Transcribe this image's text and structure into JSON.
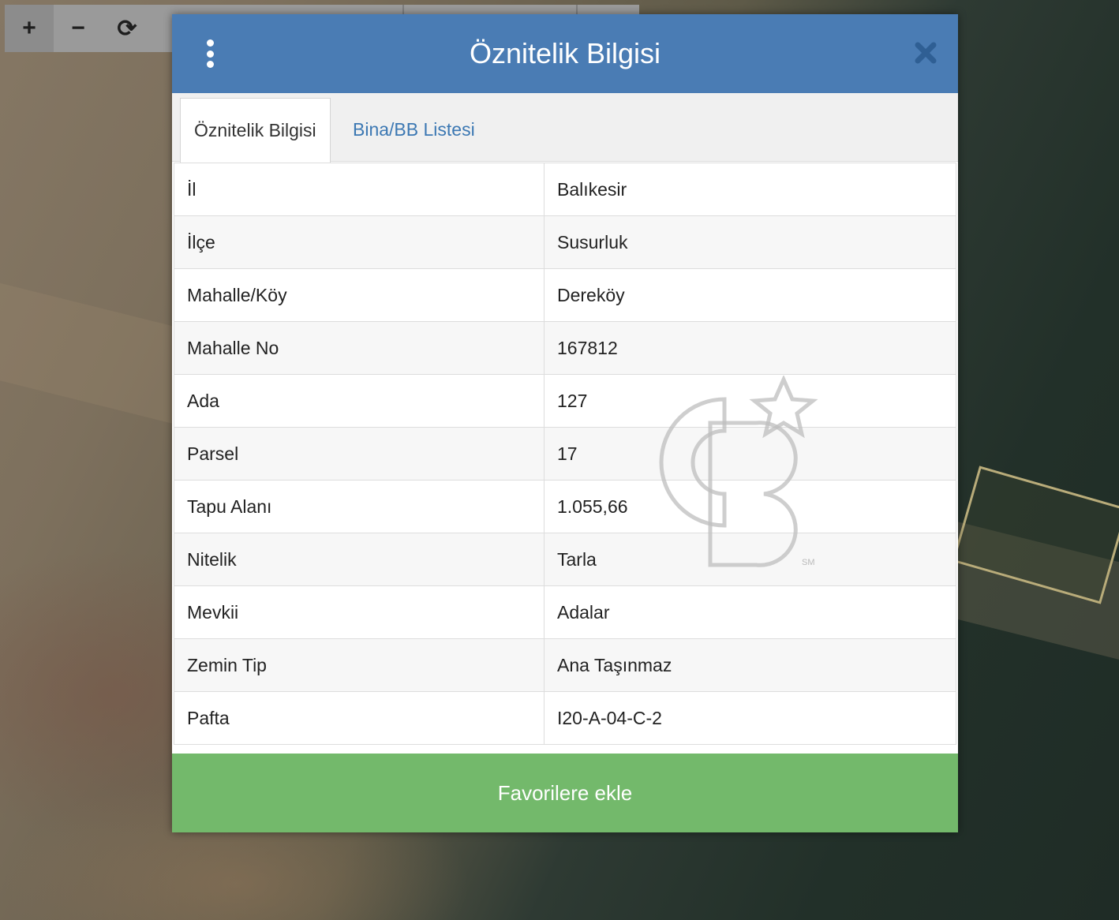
{
  "toolbar": {
    "zoom_in_icon": "plus-icon",
    "zoom_out_icon": "minus-icon",
    "refresh_icon": "refresh-icon",
    "zoom_in_label": "+",
    "zoom_out_label": "−",
    "refresh_label": "⟳"
  },
  "dialog": {
    "title": "Öznitelik Bilgisi",
    "header_color": "#4a7cb4",
    "tabs": [
      {
        "label": "Öznitelik Bilgisi",
        "active": true
      },
      {
        "label": "Bina/BB Listesi",
        "active": false
      }
    ],
    "rows": [
      {
        "key": "İl",
        "value": "Balıkesir"
      },
      {
        "key": "İlçe",
        "value": "Susurluk"
      },
      {
        "key": "Mahalle/Köy",
        "value": "Dereköy"
      },
      {
        "key": "Mahalle No",
        "value": "167812"
      },
      {
        "key": "Ada",
        "value": "127"
      },
      {
        "key": "Parsel",
        "value": "17"
      },
      {
        "key": "Tapu Alanı",
        "value": "1.055,66"
      },
      {
        "key": "Nitelik",
        "value": "Tarla"
      },
      {
        "key": "Mevkii",
        "value": "Adalar"
      },
      {
        "key": "Zemin Tip",
        "value": "Ana Taşınmaz"
      },
      {
        "key": "Pafta",
        "value": "I20-A-04-C-2"
      }
    ],
    "favorite_button": "Favorilere ekle",
    "favorite_color": "#73b96b"
  },
  "watermark": {
    "mark": "CB",
    "sm": "SM"
  }
}
